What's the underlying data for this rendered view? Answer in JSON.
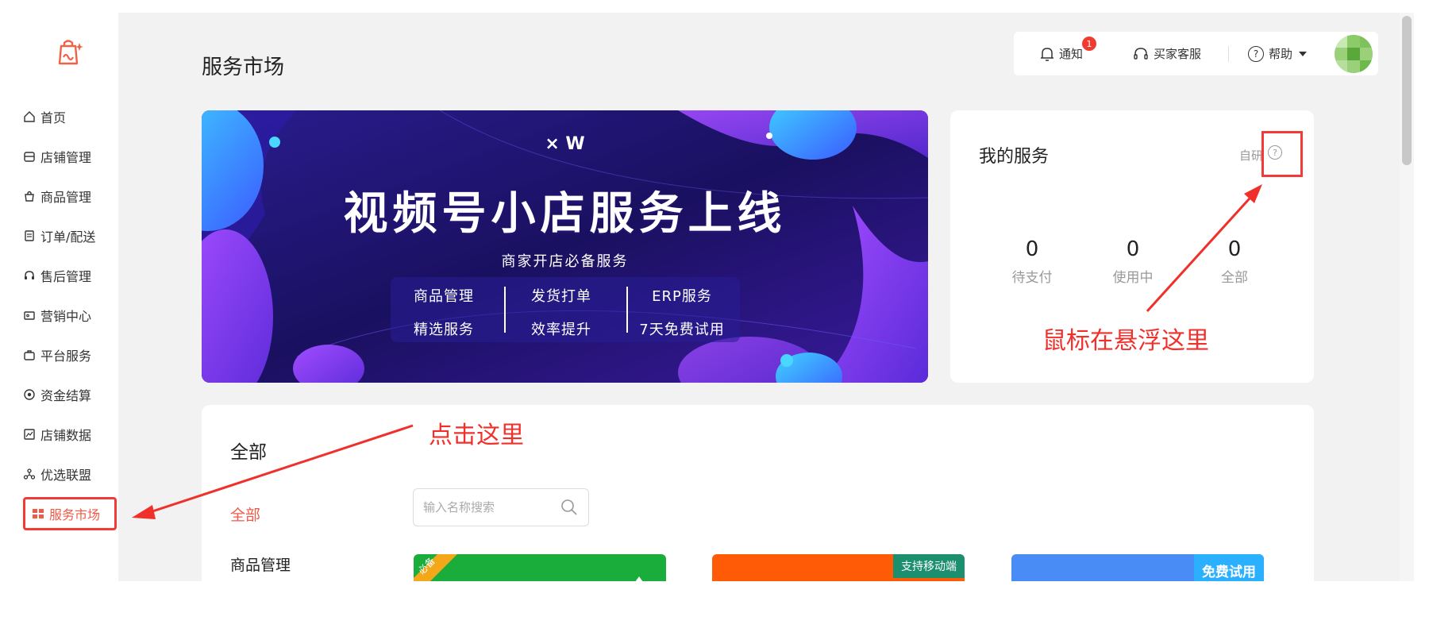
{
  "sidebar": {
    "items": [
      {
        "label": "首页",
        "icon": "home-icon"
      },
      {
        "label": "店铺管理",
        "icon": "store-icon"
      },
      {
        "label": "商品管理",
        "icon": "bag-icon"
      },
      {
        "label": "订单/配送",
        "icon": "order-icon"
      },
      {
        "label": "售后管理",
        "icon": "headset-icon"
      },
      {
        "label": "营销中心",
        "icon": "coupon-icon"
      },
      {
        "label": "平台服务",
        "icon": "briefcase-icon"
      },
      {
        "label": "资金结算",
        "icon": "coin-icon"
      },
      {
        "label": "店铺数据",
        "icon": "chart-icon"
      },
      {
        "label": "优选联盟",
        "icon": "network-icon"
      },
      {
        "label": "服务市场",
        "icon": "grid-icon",
        "active": true
      }
    ]
  },
  "header": {
    "page_title": "服务市场",
    "notify_label": "通知",
    "notify_count": "1",
    "service_label": "买家客服",
    "help_label": "帮助"
  },
  "banner": {
    "logo_text": "× W",
    "headline": "视频号小店服务上线",
    "subtitle": "商家开店必备服务",
    "features": [
      "商品管理",
      "发货打单",
      "ERP服务",
      "精选服务",
      "效率提升",
      "7天免费试用"
    ]
  },
  "my_service": {
    "title": "我的服务",
    "self_label": "自研",
    "help_icon": "?",
    "stats": [
      {
        "value": "0",
        "label": "待支付"
      },
      {
        "value": "0",
        "label": "使用中"
      },
      {
        "value": "0",
        "label": "全部"
      }
    ]
  },
  "annotations": {
    "hover": "鼠标在悬浮这里",
    "click": "点击这里"
  },
  "list": {
    "title": "全部",
    "categories": [
      "全部",
      "商品管理"
    ],
    "search_placeholder": "输入名称搜索",
    "cards": [
      {
        "tag": "必备",
        "color": "#1aad3b"
      },
      {
        "tag": "支持移动端",
        "color": "#ff5a05"
      },
      {
        "tag": "免费试用",
        "color": "#3d8af7"
      }
    ]
  },
  "colors": {
    "accent": "#f05a48",
    "annotation": "#f0302a"
  }
}
